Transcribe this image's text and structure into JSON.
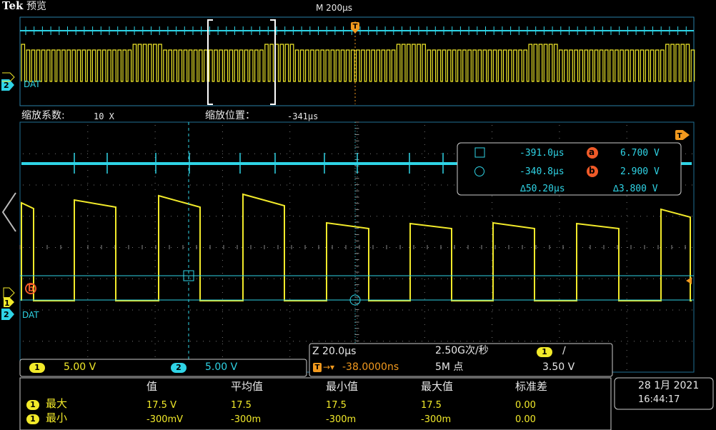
{
  "header": {
    "brand": "Tek",
    "mode": "预览",
    "timebase": "M 200µs"
  },
  "overview": {
    "ch2_marker": "2",
    "ch2_label": "DAT"
  },
  "zoom_info": {
    "factor_label": "缩放系数:",
    "factor_value": "10 X",
    "position_label": "缩放位置：",
    "position_value": "-341µs"
  },
  "main": {
    "ch1_marker": "1",
    "ch2_marker": "2",
    "ch2_label": "DAT",
    "ref_b_marker": "b",
    "trigger_marker": "T"
  },
  "cursor_readout": {
    "row1": {
      "time": "-391.0µs",
      "badge": "a",
      "volt": "6.700 V"
    },
    "row2": {
      "time": "-340.8µs",
      "badge": "b",
      "volt": "2.900 V"
    },
    "delta_time": "∆50.20µs",
    "delta_volt": "∆3.800 V"
  },
  "channel_bar": {
    "ch1_num": "1",
    "ch1_scale": "5.00 V",
    "ch2_num": "2",
    "ch2_scale": "5.00 V"
  },
  "horizontal_info": {
    "zoom_scale": "Z 20.0µs",
    "sample_rate": "2.50G次/秒",
    "trig_src": "1",
    "trig_slope": "∕",
    "trig_delay_icon": "T",
    "trig_delay": "-38.0000ns",
    "record_length": "5M 点",
    "trig_level": "3.50 V"
  },
  "measurements": {
    "headers": [
      "值",
      "平均值",
      "最小值",
      "最大值",
      "标准差"
    ],
    "rows": [
      {
        "ch": "1",
        "name": "最大",
        "values": [
          "17.5 V",
          "17.5",
          "17.5",
          "17.5",
          "0.00"
        ]
      },
      {
        "ch": "1",
        "name": "最小",
        "values": [
          "-300mV",
          "-300m",
          "-300m",
          "-300m",
          "0.00"
        ]
      }
    ]
  },
  "datetime": {
    "date": "28 1月 2021",
    "time": "16:44:17"
  },
  "colors": {
    "ch1": "#f2ea2a",
    "ch2": "#2fd4e6",
    "ref": "#f05a28",
    "trigger": "#f39a1e"
  }
}
